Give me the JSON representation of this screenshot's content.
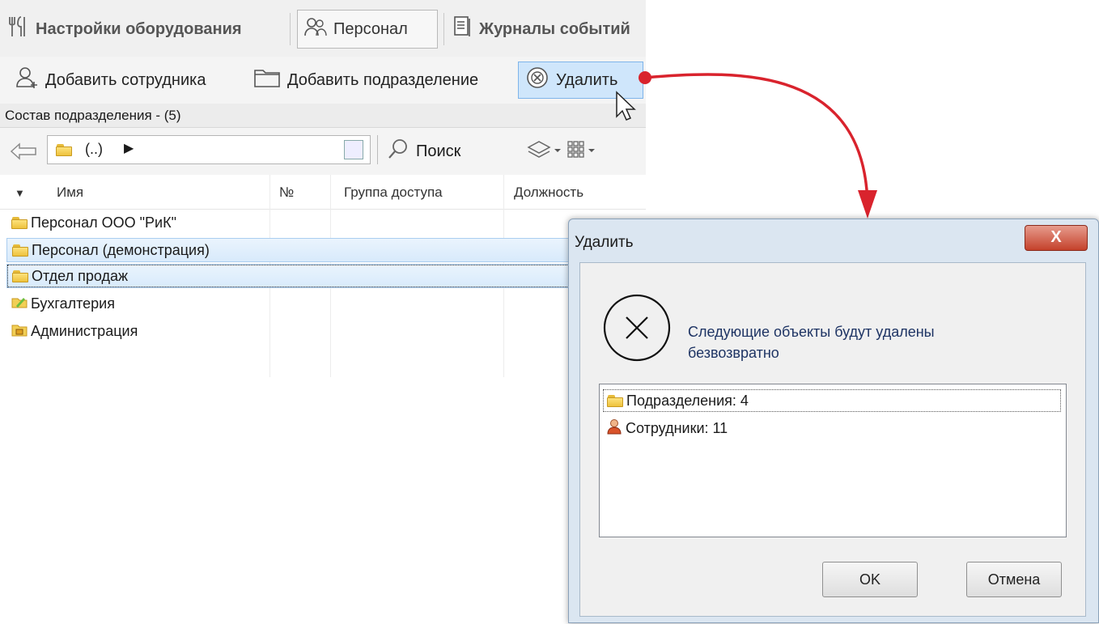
{
  "tabs": [
    {
      "label": "Настройки оборудования",
      "icon": "tools-icon"
    },
    {
      "label": "Персонал",
      "icon": "people-icon"
    },
    {
      "label": "Журналы событий",
      "icon": "journal-icon"
    }
  ],
  "toolbar": {
    "add_employee": "Добавить сотрудника",
    "add_department": "Добавить подразделение",
    "delete": "Удалить"
  },
  "status": "Состав подразделения - (5)",
  "address": {
    "path": "(..)",
    "search": "Поиск"
  },
  "columns": [
    "Имя",
    "№",
    "Группа доступа",
    "Должность"
  ],
  "rows": [
    {
      "name": "Персонал ООО \"РиК\""
    },
    {
      "name": "Персонал (демонстрация)"
    },
    {
      "name": "Отдел продаж"
    },
    {
      "name": "Бухгалтерия"
    },
    {
      "name": "Администрация"
    }
  ],
  "dialog": {
    "title": "Удалить",
    "close": "X",
    "message_line1": "Следующие объекты будут удалены",
    "message_line2": "безвозвратно",
    "items": [
      "Подразделения: 4",
      "Сотрудники: 11"
    ],
    "ok": "OK",
    "cancel": "Отмена"
  },
  "colors": {
    "accent": "#cfe6fb",
    "arrow": "#d9232d",
    "dialog_frame": "#dbe6f1"
  }
}
